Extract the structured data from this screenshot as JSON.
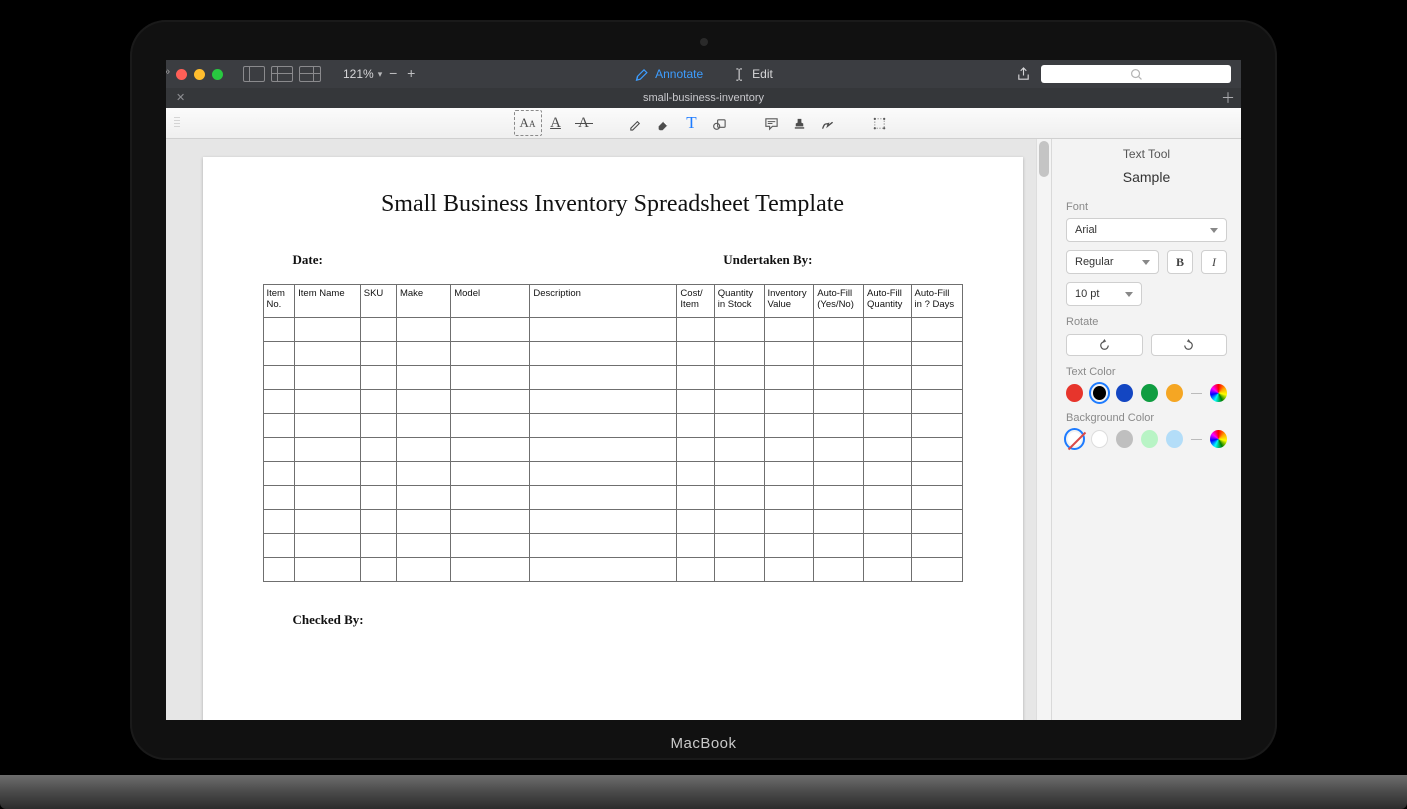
{
  "toolbar": {
    "zoom": "121%",
    "annotate_label": "Annotate",
    "edit_label": "Edit"
  },
  "tab": {
    "title": "small-business-inventory"
  },
  "document": {
    "title": "Small Business Inventory Spreadsheet Template",
    "date_label": "Date:",
    "undertaken_label": "Undertaken By:",
    "checked_label": "Checked By:",
    "columns": [
      "Item No.",
      "Item Name",
      "SKU",
      "Make",
      "Model",
      "Description",
      "Cost/ Item",
      "Quantity in Stock",
      "Inventory Value",
      "Auto-Fill (Yes/No)",
      "Auto-Fill Quantity",
      "Auto-Fill in ? Days"
    ]
  },
  "inspector": {
    "title": "Text Tool",
    "sample": "Sample",
    "font_label": "Font",
    "font_value": "Arial",
    "style_value": "Regular",
    "bold_label": "B",
    "italic_label": "I",
    "size_value": "10 pt",
    "rotate_label": "Rotate",
    "text_color_label": "Text Color",
    "text_colors": [
      "#e7352c",
      "#000000",
      "#1346c2",
      "#0f9d41",
      "#f5a623"
    ],
    "text_color_selected_index": 1,
    "bg_label": "Background Color",
    "bg_colors": [
      "none",
      "#ffffff",
      "#bfbfbf",
      "#b8f4c5",
      "#b3ddf8"
    ]
  },
  "device": {
    "label": "MacBook"
  }
}
